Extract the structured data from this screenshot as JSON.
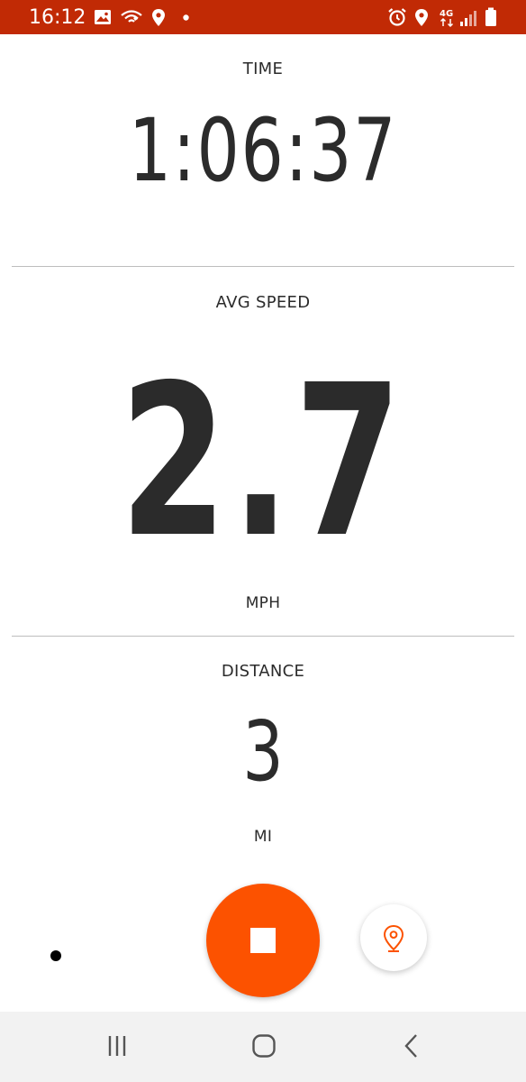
{
  "status_bar": {
    "time": "16:12",
    "background": "#c12a05",
    "left_icons": [
      "image-icon",
      "wifi-calling-icon",
      "location-icon",
      "dot-icon"
    ],
    "right_icons": [
      "alarm-icon",
      "location-icon",
      "network-4g-icon",
      "signal-icon",
      "battery-icon"
    ],
    "network_label": "4G"
  },
  "metrics": {
    "time": {
      "label": "TIME",
      "value": "1:06:37"
    },
    "avg_speed": {
      "label": "AVG SPEED",
      "value": "2.7",
      "unit": "MPH"
    },
    "distance": {
      "label": "DISTANCE",
      "value": "3",
      "unit": "MI"
    }
  },
  "controls": {
    "stop_button": {
      "icon": "stop-icon",
      "color": "#fc5200"
    },
    "route_button": {
      "icon": "map-pin-icon",
      "color": "#fc5200"
    },
    "gps_indicator": {
      "icon": "dot-icon"
    }
  },
  "nav_bar": {
    "buttons": [
      "recent-apps-icon",
      "home-icon",
      "back-icon"
    ]
  }
}
